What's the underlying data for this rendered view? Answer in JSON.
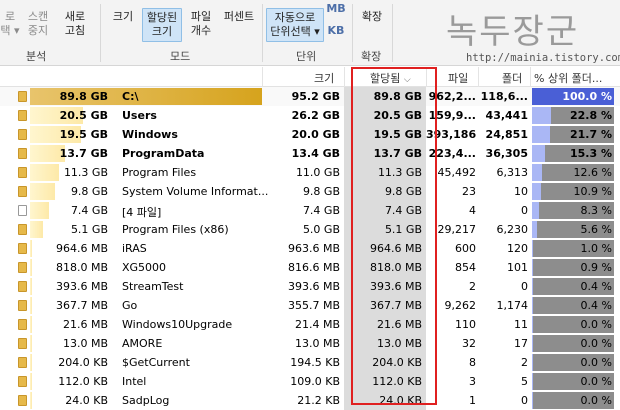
{
  "ribbon": {
    "btn_left_1": "로",
    "btn_left_2": "택 ▾",
    "btn_scan_1": "스캔",
    "btn_scan_2": "중지",
    "btn_refresh_1": "새로",
    "btn_refresh_2": "고침",
    "group_analysis": "분석",
    "btn_size": "크기",
    "btn_alloc_1": "할당된",
    "btn_alloc_2": "크기",
    "btn_files_1": "파일",
    "btn_files_2": "개수",
    "btn_percent": "퍼센트",
    "group_mode": "모드",
    "btn_auto_1": "자동으로",
    "btn_auto_2": "단위선택 ▾",
    "btn_mb": "MB",
    "btn_kb": "KB",
    "group_unit": "단위",
    "btn_expand": "확장",
    "group_expand": "확장",
    "watermark": "녹두장군",
    "site": "http://mainia.tistory.com"
  },
  "columns": {
    "size": "크기",
    "allocated": "할당됨",
    "files": "파일",
    "folders": "폴더",
    "percent": "% 상위 폴더..."
  },
  "accent": {
    "pct_fill": "#aab7f5",
    "selected_pct": "#4a5fd6",
    "highlight": "#e02020",
    "size_bar": "#fde9a8"
  },
  "rows": [
    {
      "size_label": "89.8 GB",
      "name": "C:\\",
      "size": "95.2 GB",
      "allocated": "89.8 GB",
      "files": "962,2...",
      "folders": "118,6...",
      "percent": "100.0 %",
      "pct_value": 100,
      "bar_pct": 100,
      "bold": true,
      "selected": true,
      "icon": "drive-icon"
    },
    {
      "size_label": "20.5 GB",
      "name": "Users",
      "size": "26.2 GB",
      "allocated": "20.5 GB",
      "files": "159,9...",
      "folders": "43,441",
      "percent": "22.8 %",
      "pct_value": 22.8,
      "bar_pct": 23,
      "bold": true,
      "icon": "folder-icon"
    },
    {
      "size_label": "19.5 GB",
      "name": "Windows",
      "size": "20.0 GB",
      "allocated": "19.5 GB",
      "files": "393,186",
      "folders": "24,851",
      "percent": "21.7 %",
      "pct_value": 21.7,
      "bar_pct": 22,
      "bold": true,
      "icon": "folder-icon"
    },
    {
      "size_label": "13.7 GB",
      "name": "ProgramData",
      "size": "13.4 GB",
      "allocated": "13.7 GB",
      "files": "223,4...",
      "folders": "36,305",
      "percent": "15.3 %",
      "pct_value": 15.3,
      "bar_pct": 15,
      "bold": true,
      "icon": "folder-icon"
    },
    {
      "size_label": "11.3 GB",
      "name": "Program Files",
      "size": "11.0 GB",
      "allocated": "11.3 GB",
      "files": "45,492",
      "folders": "6,313",
      "percent": "12.6 %",
      "pct_value": 12.6,
      "bar_pct": 12.6,
      "icon": "folder-icon"
    },
    {
      "size_label": "9.8 GB",
      "name": "System Volume Informat...",
      "size": "9.8 GB",
      "allocated": "9.8 GB",
      "files": "23",
      "folders": "10",
      "percent": "10.9 %",
      "pct_value": 10.9,
      "bar_pct": 10.9,
      "icon": "folder-icon"
    },
    {
      "size_label": "7.4 GB",
      "name": "[4 파일]",
      "size": "7.4 GB",
      "allocated": "7.4 GB",
      "files": "4",
      "folders": "0",
      "percent": "8.3 %",
      "pct_value": 8.3,
      "bar_pct": 8.3,
      "icon": "file-icon"
    },
    {
      "size_label": "5.1 GB",
      "name": "Program Files (x86)",
      "size": "5.0 GB",
      "allocated": "5.1 GB",
      "files": "29,217",
      "folders": "6,230",
      "percent": "5.6 %",
      "pct_value": 5.6,
      "bar_pct": 5.6,
      "icon": "folder-icon"
    },
    {
      "size_label": "964.6 MB",
      "name": "iRAS",
      "size": "963.6 MB",
      "allocated": "964.6 MB",
      "files": "600",
      "folders": "120",
      "percent": "1.0 %",
      "pct_value": 1.0,
      "bar_pct": 1.0,
      "icon": "folder-icon"
    },
    {
      "size_label": "818.0 MB",
      "name": "XG5000",
      "size": "816.6 MB",
      "allocated": "818.0 MB",
      "files": "854",
      "folders": "101",
      "percent": "0.9 %",
      "pct_value": 0.9,
      "bar_pct": 0.9,
      "icon": "folder-icon"
    },
    {
      "size_label": "393.6 MB",
      "name": "StreamTest",
      "size": "393.6 MB",
      "allocated": "393.6 MB",
      "files": "2",
      "folders": "0",
      "percent": "0.4 %",
      "pct_value": 0.4,
      "bar_pct": 0.4,
      "icon": "folder-icon"
    },
    {
      "size_label": "367.7 MB",
      "name": "Go",
      "size": "355.7 MB",
      "allocated": "367.7 MB",
      "files": "9,262",
      "folders": "1,174",
      "percent": "0.4 %",
      "pct_value": 0.4,
      "bar_pct": 0.4,
      "icon": "folder-icon"
    },
    {
      "size_label": "21.6 MB",
      "name": "Windows10Upgrade",
      "size": "21.4 MB",
      "allocated": "21.6 MB",
      "files": "110",
      "folders": "11",
      "percent": "0.0 %",
      "pct_value": 0.0,
      "bar_pct": 0.05,
      "icon": "folder-icon"
    },
    {
      "size_label": "13.0 MB",
      "name": "AMORE",
      "size": "13.0 MB",
      "allocated": "13.0 MB",
      "files": "32",
      "folders": "17",
      "percent": "0.0 %",
      "pct_value": 0.0,
      "bar_pct": 0.03,
      "icon": "folder-icon"
    },
    {
      "size_label": "204.0 KB",
      "name": "$GetCurrent",
      "size": "194.5 KB",
      "allocated": "204.0 KB",
      "files": "8",
      "folders": "2",
      "percent": "0.0 %",
      "pct_value": 0.0,
      "bar_pct": 0.01,
      "icon": "folder-icon"
    },
    {
      "size_label": "112.0 KB",
      "name": "Intel",
      "size": "109.0 KB",
      "allocated": "112.0 KB",
      "files": "3",
      "folders": "5",
      "percent": "0.0 %",
      "pct_value": 0.0,
      "bar_pct": 0.01,
      "icon": "folder-icon"
    },
    {
      "size_label": "24.0 KB",
      "name": "SadpLog",
      "size": "21.2 KB",
      "allocated": "24.0 KB",
      "files": "1",
      "folders": "0",
      "percent": "0.0 %",
      "pct_value": 0.0,
      "bar_pct": 0.01,
      "icon": "folder-icon"
    }
  ]
}
